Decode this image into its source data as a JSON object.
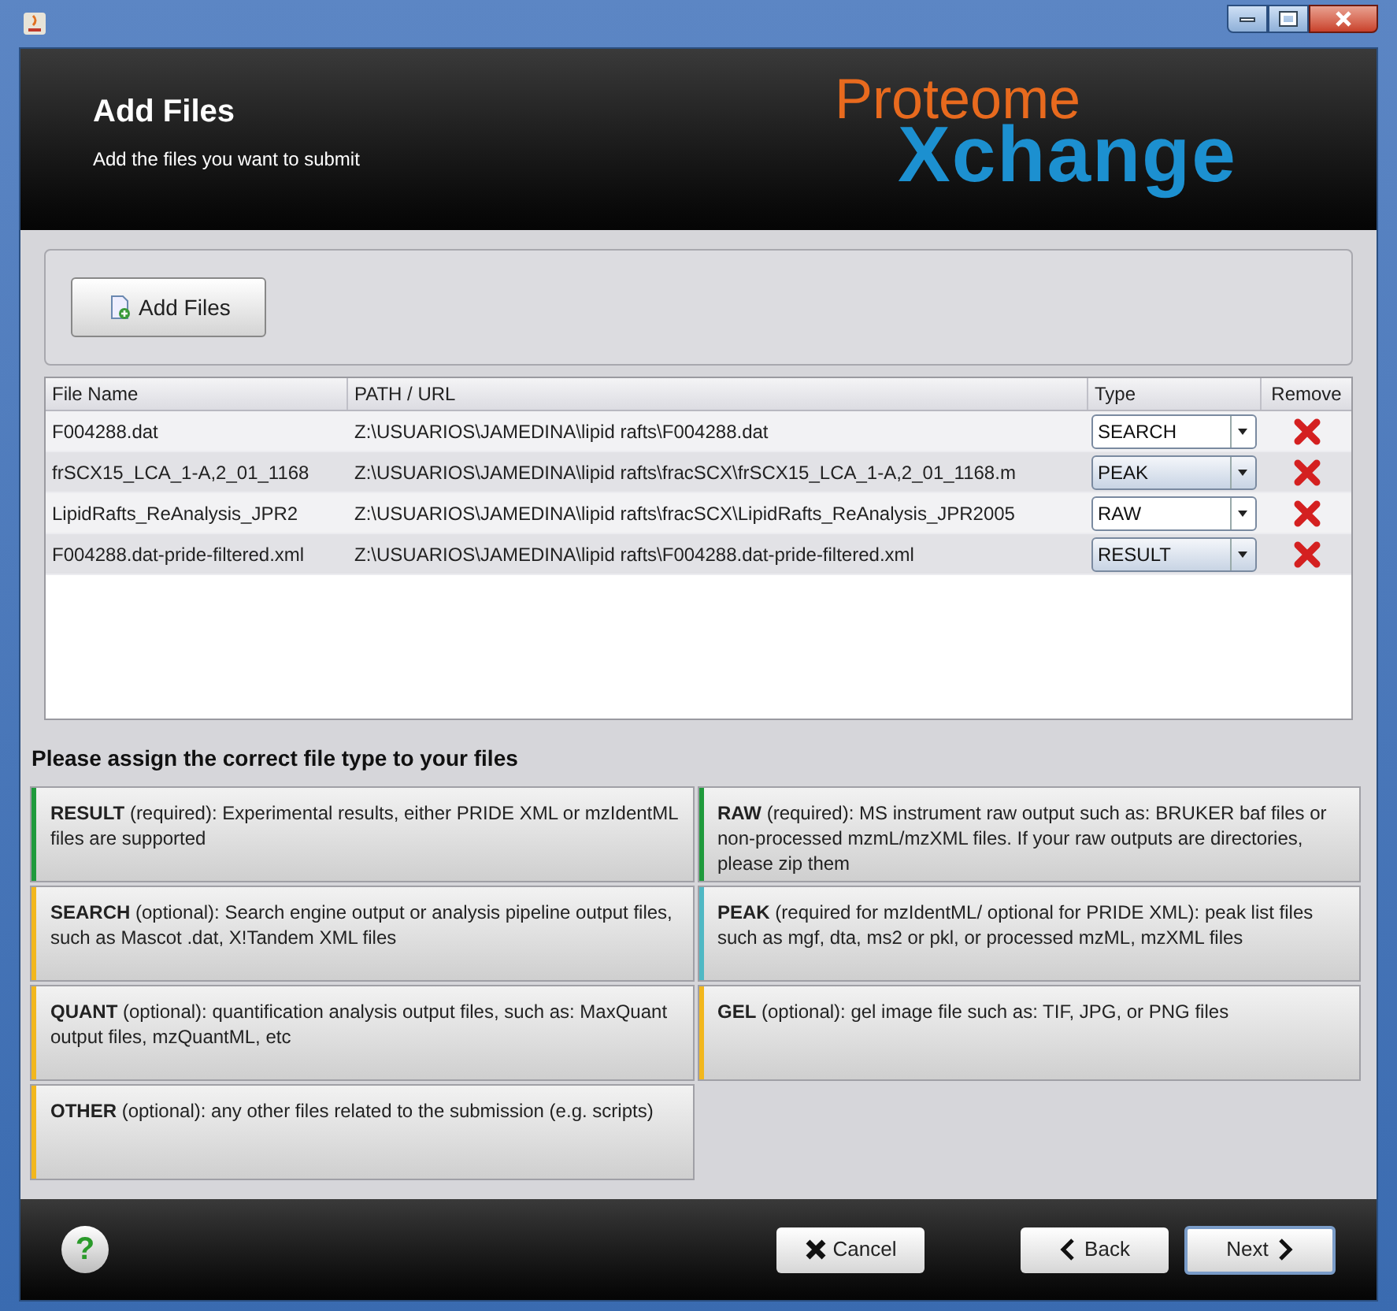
{
  "header": {
    "title": "Add Files",
    "subtitle": "Add the files you want to submit",
    "logo_top": "Proteome",
    "logo_bottom": "Xchange"
  },
  "add_button": "Add Files",
  "table": {
    "columns": [
      "File Name",
      "PATH / URL",
      "Type",
      "Remove"
    ],
    "rows": [
      {
        "name": "F004288.dat",
        "path": "Z:\\USUARIOS\\JAMEDINA\\lipid rafts\\F004288.dat",
        "type": "SEARCH"
      },
      {
        "name": "frSCX15_LCA_1-A,2_01_1168",
        "path": "Z:\\USUARIOS\\JAMEDINA\\lipid rafts\\fracSCX\\frSCX15_LCA_1-A,2_01_1168.m",
        "type": "PEAK"
      },
      {
        "name": "LipidRafts_ReAnalysis_JPR2",
        "path": "Z:\\USUARIOS\\JAMEDINA\\lipid rafts\\fracSCX\\LipidRafts_ReAnalysis_JPR2005",
        "type": "RAW"
      },
      {
        "name": "F004288.dat-pride-filtered.xml",
        "path": "Z:\\USUARIOS\\JAMEDINA\\lipid rafts\\F004288.dat-pride-filtered.xml",
        "type": "RESULT"
      }
    ]
  },
  "types_heading": "Please assign the correct file type to your files",
  "file_types": [
    {
      "text": "**RESULT** (required): Experimental results, either PRIDE XML or mzIdentML files are supported",
      "color": "#1f9a3c"
    },
    {
      "text": "**RAW** (required): MS instrument raw output such as: BRUKER baf files or non-processed mzmL/mzXML files. If your raw outputs are directories, please zip them",
      "color": "#1f9a3c"
    },
    {
      "text": "**SEARCH** (optional): Search engine output or analysis pipeline output files, such as Mascot .dat, X!Tandem XML files",
      "color": "#f2b71d"
    },
    {
      "text": "**PEAK** (required for mzIdentML/ optional for PRIDE XML): peak list files such as mgf, dta, ms2 or pkl, or processed mzML, mzXML files",
      "color": "#4fb8c4"
    },
    {
      "text": "**QUANT** (optional): quantification analysis output files, such as: MaxQuant output files, mzQuantML, etc",
      "color": "#f2b71d"
    },
    {
      "text": "**GEL** (optional): gel image file such as: TIF, JPG, or PNG files",
      "color": "#f2b71d"
    },
    {
      "text": "**OTHER** (optional): any other files related to the submission (e.g. scripts)",
      "color": "#f2b71d"
    }
  ],
  "footer": {
    "help": "?",
    "cancel": "Cancel",
    "back": "Back",
    "next": "Next"
  }
}
